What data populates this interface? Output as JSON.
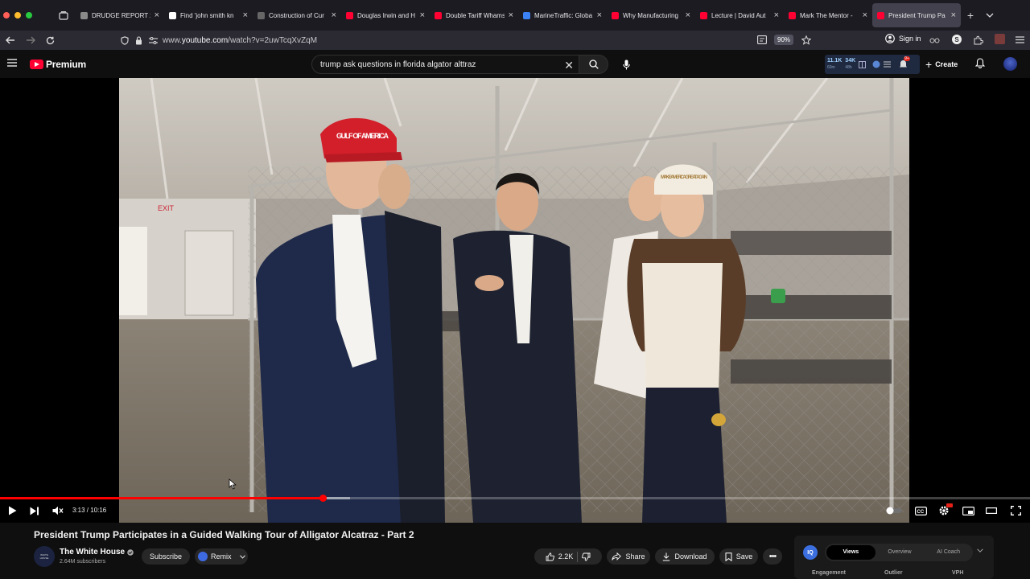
{
  "browser": {
    "tabs": [
      {
        "label": "DRUDGE REPORT 2",
        "favicon_color": "#8a8a8a"
      },
      {
        "label": "Find 'john smith kn",
        "favicon_color": "#ffffff"
      },
      {
        "label": "Construction of Cur",
        "favicon_color": "#666666"
      },
      {
        "label": "Douglas Irwin and H",
        "favicon_color": "#ff0033"
      },
      {
        "label": "Double Tariff Whams",
        "favicon_color": "#ff0033"
      },
      {
        "label": "MarineTraffic: Globa",
        "favicon_color": "#3b82f6"
      },
      {
        "label": "Why Manufacturing",
        "favicon_color": "#ff0033"
      },
      {
        "label": "Lecture | David Aut",
        "favicon_color": "#ff0033"
      },
      {
        "label": "Mark The Mentor -",
        "favicon_color": "#ff0033"
      },
      {
        "label": "President Trump Pa",
        "favicon_color": "#ff0033"
      }
    ],
    "active_tab_index": 9,
    "url_prefix": "www.",
    "url_domain": "youtube.com",
    "url_path": "/watch?v=2uwTcqXvZqM",
    "zoom_level": "90%",
    "sign_in_label": "Sign in"
  },
  "youtube": {
    "brand": "Premium",
    "search_query": "trump ask questions in florida algator alttraz",
    "stats_extension": {
      "views_primary": "11.1K",
      "views_secondary": "60m",
      "likes_primary": "34K",
      "likes_secondary": "48h",
      "notif_count": "9+"
    },
    "create_label": "Create"
  },
  "player": {
    "current_time": "3:13",
    "duration": "10:16",
    "timecode": "3:13 / 10:16",
    "progress_fraction": 0.3133,
    "buffer_fraction": 0.34,
    "hat_left_text": "GULF OF AMERICA",
    "hat_right_text": "MAKE AMERICA GREAT AGAIN",
    "exit_sign": "EXIT"
  },
  "video": {
    "title": "President Trump Participates in a Guided Walking Tour of Alligator Alcatraz - Part 2",
    "channel_name": "The White House",
    "channel_avatar_text": "WHITE HOUSE",
    "subscriber_count": "2.64M subscribers",
    "subscribe_label": "Subscribe",
    "remix_label": "Remix",
    "like_count": "2.2K",
    "share_label": "Share",
    "download_label": "Download",
    "save_label": "Save"
  },
  "iq_panel": {
    "badge": "IQ",
    "tabs": [
      "Views",
      "Overview",
      "AI Coach"
    ],
    "active_tab": "Views",
    "metrics": [
      "Engagement",
      "Outlier",
      "VPH"
    ]
  }
}
